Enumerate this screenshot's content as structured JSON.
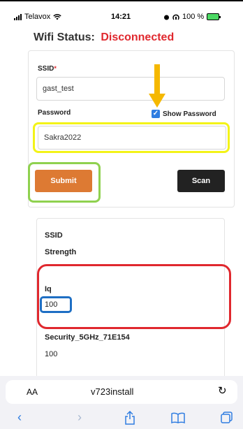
{
  "status_bar": {
    "carrier": "Telavox",
    "wifi_icon": "wifi-icon",
    "time": "14:21",
    "battery_text": "100 %",
    "colors": {
      "battery": "#4cd964"
    }
  },
  "wifi_status": {
    "label": "Wifi Status:",
    "state": "Disconnected",
    "colors": {
      "state": "#e0282e"
    }
  },
  "form": {
    "ssid_label": "SSID",
    "required_mark": "*",
    "ssid_value": "gast_test",
    "password_label": "Password",
    "password_value": "Sakra2022",
    "show_password_label": "Show Password",
    "show_password_checked": true,
    "submit_label": "Submit",
    "scan_label": "Scan",
    "colors": {
      "submit": "#dd7a33",
      "scan": "#222222",
      "checkbox": "#2f7de1"
    }
  },
  "result": {
    "ssid_label": "SSID",
    "strength_label": "Strength",
    "network_name": "Iq",
    "network_strength": "100",
    "second_network_name": "Security_5GHz_71E154",
    "second_network_strength": "100"
  },
  "annotations": {
    "colors": {
      "yellow": "#f3f318",
      "green": "#8fd14f",
      "red": "#e0282e",
      "blue": "#1e6fc4",
      "arrow": "#f5b800"
    }
  },
  "browser": {
    "aa_label": "AA",
    "url": "v723install",
    "reload_icon": "reload-icon",
    "toolbar_icons": [
      "back-icon",
      "forward-icon",
      "share-icon",
      "bookmarks-icon",
      "tabs-icon"
    ]
  }
}
